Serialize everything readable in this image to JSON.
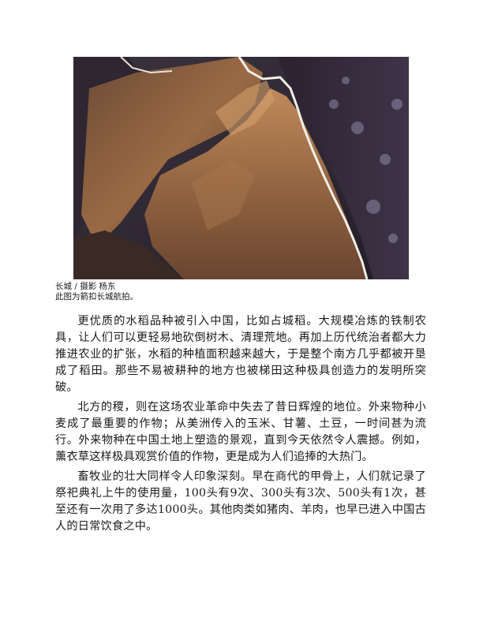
{
  "figure": {
    "credit": "长城 / 摄影 杨东",
    "description": "此图为箭扣长城航拍。"
  },
  "paragraphs": [
    "更优质的水稻品种被引入中国，比如占城稻。大规模冶炼的铁制农具，让人们可以更轻易地砍倒树木、清理荒地。再加上历代统治者都大力推进农业的扩张，水稻的种植面积越来越大，于是整个南方几乎都被开垦成了稻田。那些不易被耕种的地方也被梯田这种极具创造力的发明所突破。",
    "北方的稷，则在这场农业革命中失去了昔日辉煌的地位。外来物种小麦成了最重要的作物；从美洲传入的玉米、甘薯、土豆，一时间甚为流行。外来物种在中国土地上塑造的景观，直到今天依然令人震撼。例如，薰衣草这样极具观赏价值的作物，更是成为人们追捧的大热门。",
    "畜牧业的壮大同样令人印象深刻。早在商代的甲骨上，人们就记录了祭祀典礼上牛的使用量，100头有9次、300头有3次、500头有1次，甚至还有一次用了多达1000头。其他肉类如猪肉、羊肉，也早已进入中国古人的日常饮食之中。"
  ]
}
